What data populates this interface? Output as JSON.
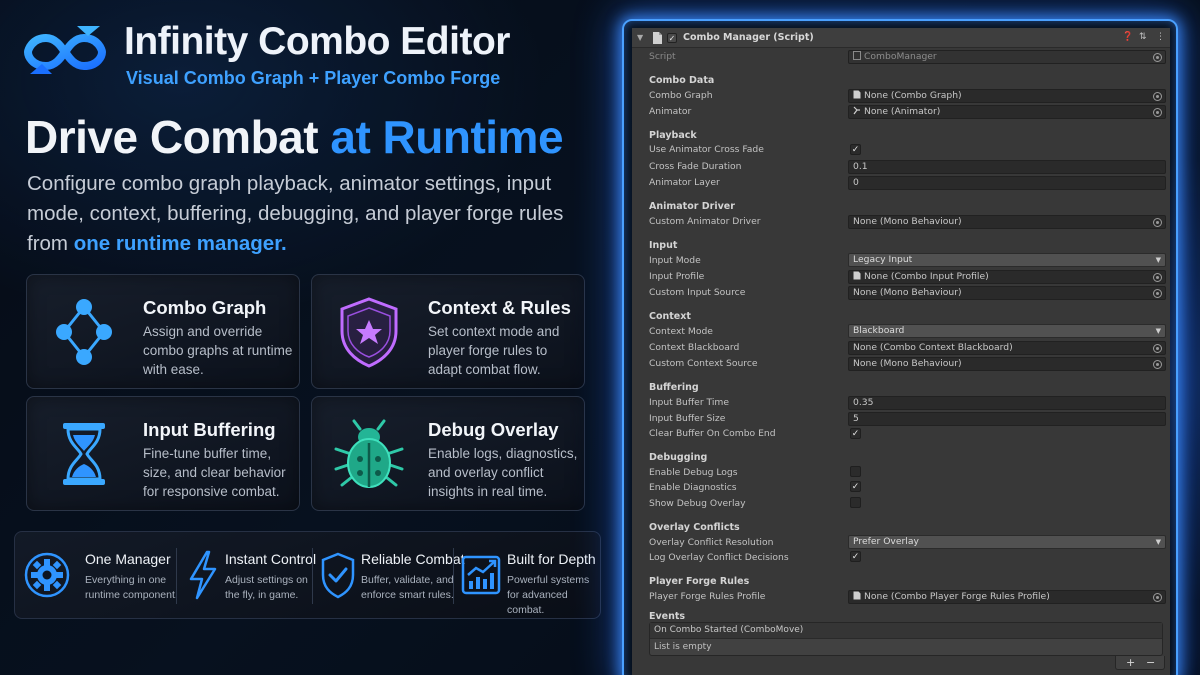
{
  "header": {
    "app_title": "Infinity Combo Editor",
    "app_subtitle": "Visual Combo Graph + Player Combo Forge",
    "logo_icon": "infinity-icon"
  },
  "hero": {
    "headline_white": "Drive Combat ",
    "headline_blue": "at Runtime",
    "description": "Configure combo graph playback, animator settings, input mode, context, buffering, debugging, and player forge rules from ",
    "description_accent": "one runtime manager."
  },
  "features": [
    {
      "title": "Combo Graph",
      "description": "Assign and override combo graphs at runtime with ease.",
      "icon": "graph-nodes-icon"
    },
    {
      "title": "Context & Rules",
      "description": "Set context mode and player forge rules to adapt combat flow.",
      "icon": "shield-star-icon"
    },
    {
      "title": "Input Buffering",
      "description": "Fine-tune buffer time, size, and clear behavior for responsive combat.",
      "icon": "hourglass-icon"
    },
    {
      "title": "Debug Overlay",
      "description": "Enable logs, diagnostics, and overlay conflict insights in real time.",
      "icon": "bug-icon"
    }
  ],
  "benefits": [
    {
      "title": "One Manager",
      "description": "Everything in one runtime component.",
      "icon": "gear-icon"
    },
    {
      "title": "Instant Control",
      "description": "Adjust settings on the fly, in game.",
      "icon": "lightning-icon"
    },
    {
      "title": "Reliable Combat",
      "description": "Buffer, validate, and enforce smart rules.",
      "icon": "shield-check-icon"
    },
    {
      "title": "Built for Depth",
      "description": "Powerful systems for advanced combat.",
      "icon": "chart-icon"
    }
  ],
  "inspector": {
    "component_title": "Combo Manager (Script)",
    "script_label": "Script",
    "script_value": "ComboManager",
    "sections": {
      "combo_data": "Combo Data",
      "playback": "Playback",
      "animator_driver": "Animator Driver",
      "input": "Input",
      "context": "Context",
      "buffering": "Buffering",
      "debugging": "Debugging",
      "overlay_conflicts": "Overlay Conflicts",
      "player_forge_rules": "Player Forge Rules",
      "events": "Events"
    },
    "fields": {
      "combo_graph": {
        "label": "Combo Graph",
        "value": "None (Combo Graph)"
      },
      "animator": {
        "label": "Animator",
        "value": "None (Animator)"
      },
      "use_cross_fade": {
        "label": "Use Animator Cross Fade",
        "checked": true
      },
      "cross_fade_duration": {
        "label": "Cross Fade Duration",
        "value": "0.1"
      },
      "animator_layer": {
        "label": "Animator Layer",
        "value": "0"
      },
      "custom_animator_driver": {
        "label": "Custom Animator Driver",
        "value": "None (Mono Behaviour)"
      },
      "input_mode": {
        "label": "Input Mode",
        "value": "Legacy Input"
      },
      "input_profile": {
        "label": "Input Profile",
        "value": "None (Combo Input Profile)"
      },
      "custom_input_source": {
        "label": "Custom Input Source",
        "value": "None (Mono Behaviour)"
      },
      "context_mode": {
        "label": "Context Mode",
        "value": "Blackboard"
      },
      "context_blackboard": {
        "label": "Context Blackboard",
        "value": "None (Combo Context Blackboard)"
      },
      "custom_context_source": {
        "label": "Custom Context Source",
        "value": "None (Mono Behaviour)"
      },
      "input_buffer_time": {
        "label": "Input Buffer Time",
        "value": "0.35"
      },
      "input_buffer_size": {
        "label": "Input Buffer Size",
        "value": "5"
      },
      "clear_buffer": {
        "label": "Clear Buffer On Combo End",
        "checked": true
      },
      "enable_debug_logs": {
        "label": "Enable Debug Logs",
        "checked": false
      },
      "enable_diagnostics": {
        "label": "Enable Diagnostics",
        "checked": true
      },
      "show_debug_overlay": {
        "label": "Show Debug Overlay",
        "checked": false
      },
      "overlay_conflict_resolution": {
        "label": "Overlay Conflict Resolution",
        "value": "Prefer Overlay"
      },
      "log_overlay_conflicts": {
        "label": "Log Overlay Conflict Decisions",
        "checked": true
      },
      "player_forge_rules_profile": {
        "label": "Player Forge Rules Profile",
        "value": "None (Combo Player Forge Rules Profile)"
      }
    },
    "events": {
      "list_header": "On Combo Started (ComboMove)",
      "empty_text": "List is empty",
      "add_label": "+",
      "remove_label": "−"
    }
  },
  "colors": {
    "accent_blue": "#2f94ff",
    "inspector_bg": "#383838",
    "glow_blue": "#4aa0ff"
  }
}
